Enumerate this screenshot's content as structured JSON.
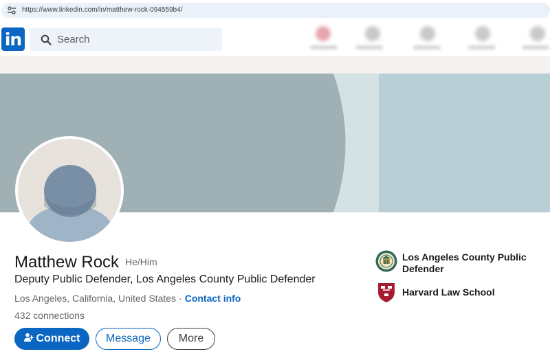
{
  "browser": {
    "url": "https://www.linkedin.com/in/matthew-rock-094559b4/"
  },
  "nav": {
    "logo_text": "in",
    "search_placeholder": "Search"
  },
  "colors": {
    "brand_blue": "#0a66c2",
    "banner_gray": "#9fb1b5",
    "banner_light": "#b9cfd6"
  },
  "profile": {
    "name": "Matthew Rock",
    "pronouns": "He/Him",
    "headline": "Deputy Public Defender, Los Angeles County Public Defender",
    "location": "Los Angeles, California, United States",
    "separator": "·",
    "contact_info": "Contact info",
    "connections": "432 connections"
  },
  "actions": {
    "connect_label": "Connect",
    "message_label": "Message",
    "more_label": "More"
  },
  "sidebar": {
    "current_employer": {
      "name_line1": "Los Angeles County Public",
      "name_line2": "Defender",
      "icon": "county-seal-icon"
    },
    "education": {
      "name": "Harvard Law School",
      "icon": "harvard-shield-icon"
    }
  }
}
